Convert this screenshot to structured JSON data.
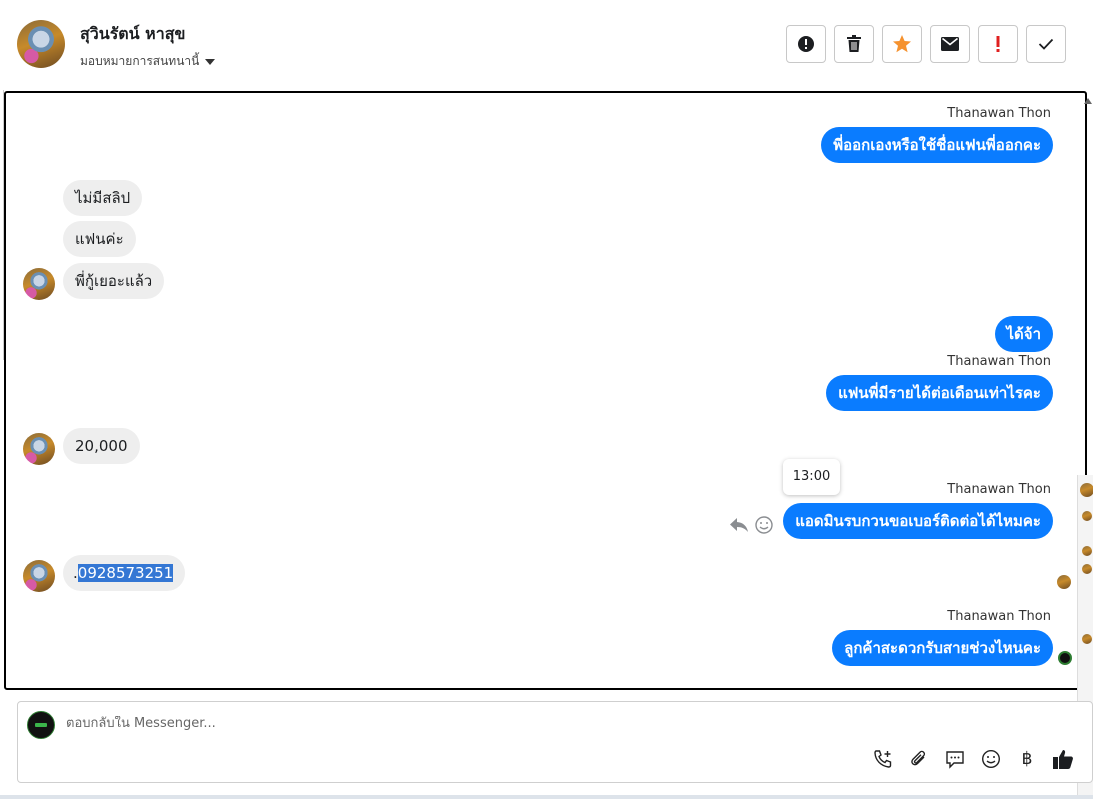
{
  "header": {
    "contact_name": "สุวินรัตน์ หาสุข",
    "assign_label": "มอบหมายการสนทนานี้",
    "actions": [
      {
        "name": "alert-action-button",
        "icon": "exclamation-circle-icon"
      },
      {
        "name": "delete-action-button",
        "icon": "trash-icon"
      },
      {
        "name": "star-action-button",
        "icon": "star-icon"
      },
      {
        "name": "mail-action-button",
        "icon": "envelope-icon"
      },
      {
        "name": "important-action-button",
        "icon": "exclamation-icon"
      },
      {
        "name": "done-action-button",
        "icon": "check-icon"
      }
    ]
  },
  "messages": {
    "sender_name": "Thanawan Thon",
    "m1": "พี่ออกเองหรือใช้ชื่อแฟนพี่ออกคะ",
    "m2": "ไม่มีสลิป",
    "m3": "แฟนค่ะ",
    "m4": "พี่กู้เยอะแล้ว",
    "m5": "ได้จ้า",
    "m6": "แฟนพี่มีรายได้ต่อเดือนเท่าไรคะ",
    "m7": "20,000",
    "m8": "แอดมินรบกวนขอเบอร์ติดต่อได้ไหมคะ",
    "m9_prefix": ".",
    "m9_selected": "0928573251",
    "m10": "ลูกค้าสะดวกรับสายช่วงไหนคะ",
    "tooltip_time": "13:00"
  },
  "composer": {
    "placeholder": "ตอบกลับใน Messenger...",
    "tools": [
      "phone-plus-icon",
      "paperclip-icon",
      "chat-bubble-icon",
      "smile-icon",
      "baht-icon",
      "thumbs-up-icon"
    ],
    "baht_symbol": "฿"
  },
  "colors": {
    "outgoing_bubble": "#0a7cff",
    "incoming_bubble": "#eeeeee",
    "star": "#f5922f",
    "important": "#e02020"
  }
}
